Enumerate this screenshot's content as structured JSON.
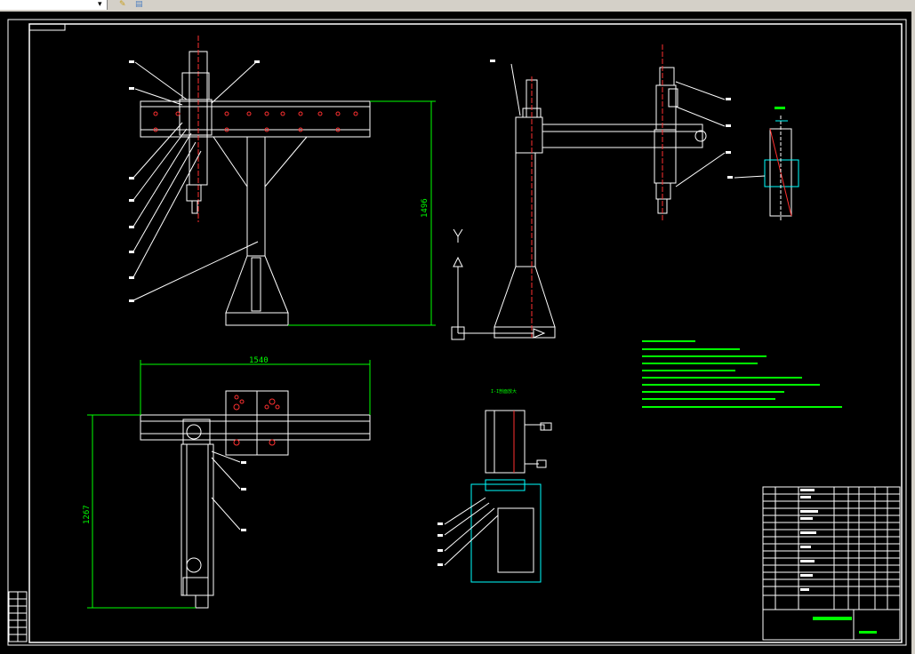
{
  "toolbar": {
    "icons": [
      "dropdown-arrow-icon",
      "layer-tools-icon",
      "layer-stack-icon"
    ]
  },
  "drawing": {
    "dim_overall_width": "1540",
    "dim_overall_depth": "1267",
    "dim_height": "1496",
    "axis_label_y": "Y",
    "detail_label": "I-I剖面放大"
  },
  "colors": {
    "background": "#000000",
    "lines": "#ffffff",
    "dimensions": "#00ff00",
    "notes": "#00ff00",
    "centerlines": "#ff0000",
    "hatch": "#00ffff"
  }
}
